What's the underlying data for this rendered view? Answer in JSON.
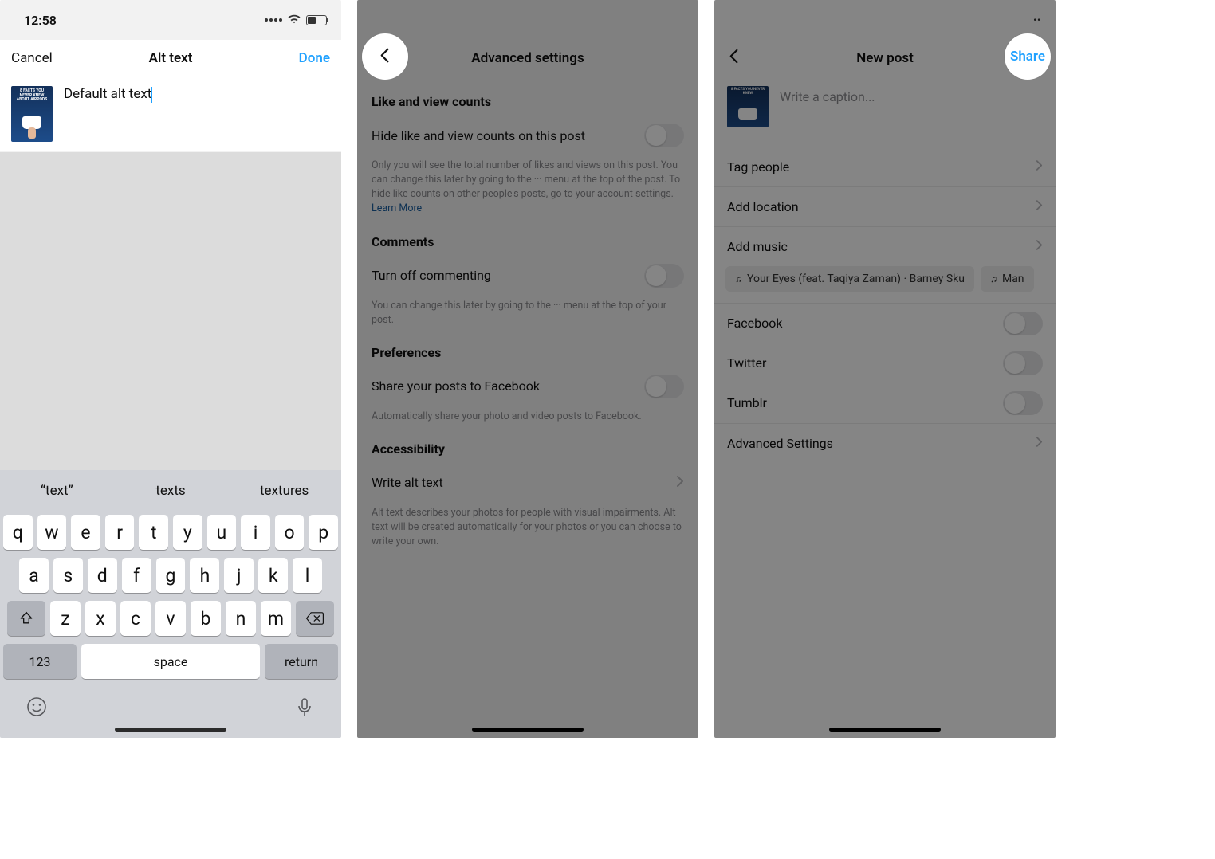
{
  "panel1": {
    "status": {
      "time": "12:58"
    },
    "nav": {
      "cancel": "Cancel",
      "title": "Alt text",
      "done": "Done"
    },
    "alt_text_value": "Default alt text",
    "suggestions": [
      "“text”",
      "texts",
      "textures"
    ],
    "keys": {
      "row1": [
        "q",
        "w",
        "e",
        "r",
        "t",
        "y",
        "u",
        "i",
        "o",
        "p"
      ],
      "row2": [
        "a",
        "s",
        "d",
        "f",
        "g",
        "h",
        "j",
        "k",
        "l"
      ],
      "row3": [
        "z",
        "x",
        "c",
        "v",
        "b",
        "n",
        "m"
      ],
      "nums": "123",
      "space": "space",
      "return": "return"
    }
  },
  "panel2": {
    "nav_title": "Advanced settings",
    "sec1": {
      "title": "Like and view counts",
      "row": "Hide like and view counts on this post",
      "helper": "Only you will see the total number of likes and views on this post. You can change this later by going to the ··· menu at the top of the post. To hide like counts on other people's posts, go to your account settings.",
      "learn_more": "Learn More"
    },
    "sec2": {
      "title": "Comments",
      "row": "Turn off commenting",
      "helper": "You can change this later by going to the ··· menu at the top of your post."
    },
    "sec3": {
      "title": "Preferences",
      "row": "Share your posts to Facebook",
      "helper": "Automatically share your photo and video posts to Facebook."
    },
    "sec4": {
      "title": "Accessibility",
      "row": "Write alt text",
      "helper": "Alt text describes your photos for people with visual impairments. Alt text will be created automatically for your photos or you can choose to write your own."
    }
  },
  "panel3": {
    "nav": {
      "title": "New post",
      "share": "Share"
    },
    "caption_placeholder": "Write a caption...",
    "rows": {
      "tag": "Tag people",
      "location": "Add location",
      "music": "Add music",
      "facebook": "Facebook",
      "twitter": "Twitter",
      "tumblr": "Tumblr",
      "advanced": "Advanced Settings"
    },
    "music_chips": [
      "Your Eyes (feat. Taqiya Zaman) · Barney Sku",
      "Man"
    ]
  }
}
